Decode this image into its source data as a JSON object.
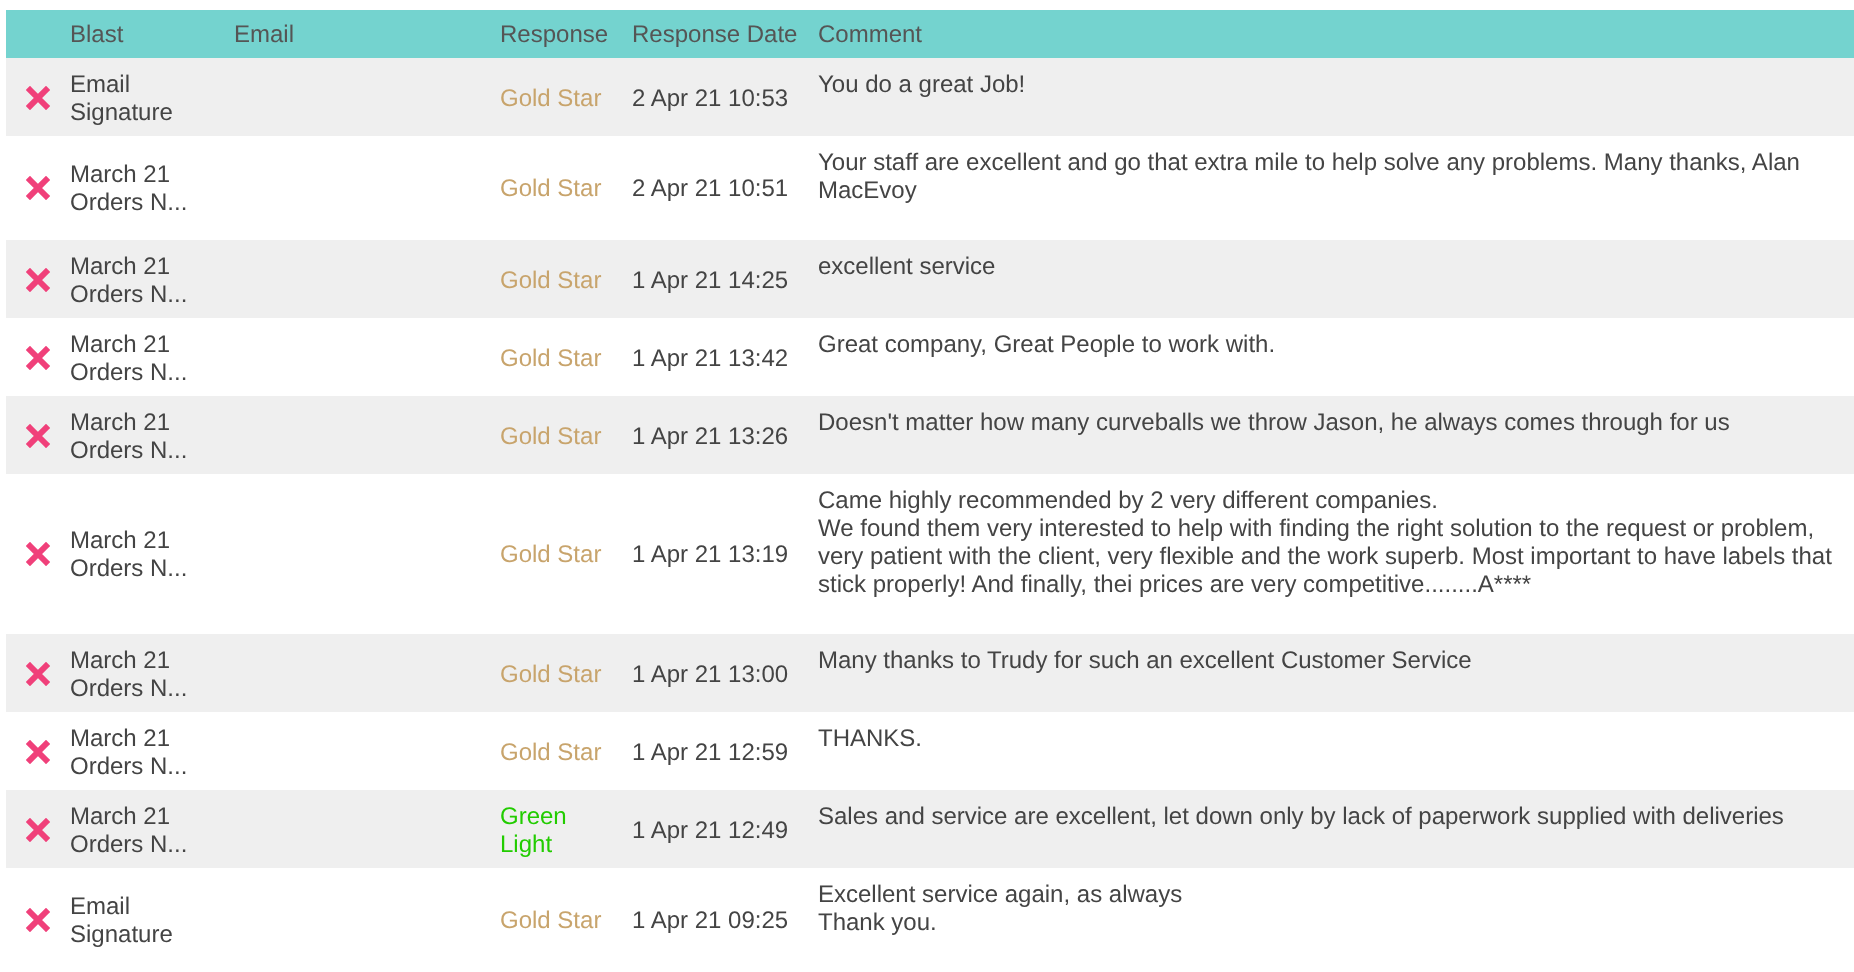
{
  "table": {
    "columns": [
      "Blast",
      "Email",
      "Response",
      "Response Date",
      "Comment"
    ],
    "rows": [
      {
        "blast": "Email Signature",
        "response": "Gold Star",
        "color": "#c8a46c",
        "date": "2 Apr 21 10:53",
        "comment": "You do a great Job!"
      },
      {
        "blast": "March 21 Orders N...",
        "response": "Gold Star",
        "color": "#c8a46c",
        "date": "2 Apr 21 10:51",
        "comment": "Your staff are excellent and go that extra mile to help solve any problems. Many thanks, Alan MacEvoy"
      },
      {
        "blast": "March 21 Orders N...",
        "response": "Gold Star",
        "color": "#c8a46c",
        "date": "1 Apr 21 14:25",
        "comment": "excellent service"
      },
      {
        "blast": "March 21 Orders N...",
        "response": "Gold Star",
        "color": "#c8a46c",
        "date": "1 Apr 21 13:42",
        "comment": "Great company, Great People to work with."
      },
      {
        "blast": "March 21 Orders N...",
        "response": "Gold Star",
        "color": "#c8a46c",
        "date": "1 Apr 21 13:26",
        "comment": "Doesn't matter how many curveballs we throw Jason, he always comes through for us"
      },
      {
        "blast": "March 21 Orders N...",
        "response": "Gold Star",
        "color": "#c8a46c",
        "date": "1 Apr 21 13:19",
        "comment": "Came highly recommended by 2 very different companies.\nWe found them very interested to help with finding the right solution to the request or problem, very patient with the client, very flexible and the work superb. Most important to have labels that stick properly! And finally, thei prices are very competitive........A****"
      },
      {
        "blast": "March 21 Orders N...",
        "response": "Gold Star",
        "color": "#c8a46c",
        "date": "1 Apr 21 13:00",
        "comment": "Many thanks to Trudy for such an excellent Customer Service"
      },
      {
        "blast": "March 21 Orders N...",
        "response": "Gold Star",
        "color": "#c8a46c",
        "date": "1 Apr 21 12:59",
        "comment": "THANKS."
      },
      {
        "blast": "March 21 Orders N...",
        "response": "Green Light",
        "color": "#22cc00",
        "date": "1 Apr 21 12:49",
        "comment": "Sales and service are excellent, let down only by lack of paperwork supplied with deliveries"
      },
      {
        "blast": "Email Signature",
        "response": "Gold Star",
        "color": "#c8a46c",
        "date": "1 Apr 21 09:25",
        "comment": "Excellent service again, as always\nThank you."
      }
    ]
  }
}
